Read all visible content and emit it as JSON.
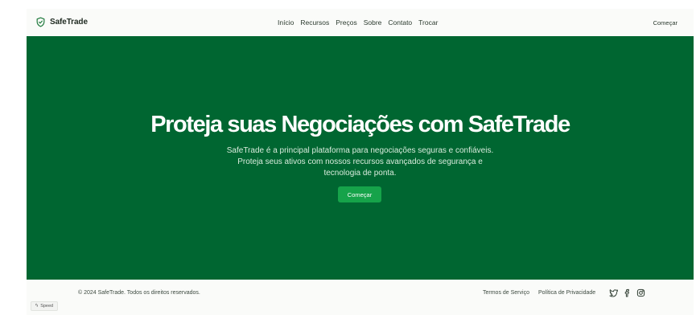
{
  "header": {
    "brand": "SafeTrade",
    "nav": [
      "Início",
      "Recursos",
      "Preços",
      "Sobre",
      "Contato",
      "Trocar"
    ],
    "cta": "Começar"
  },
  "hero": {
    "title": "Proteja suas Negociações com SafeTrade",
    "subtitle": "SafeTrade é a principal plataforma para negociações seguras e confiáveis. Proteja seus ativos com nossos recursos avançados de segurança e tecnologia de ponta.",
    "button": "Começar",
    "background_color": "#006631",
    "button_color": "#16a34a"
  },
  "footer": {
    "copyright": "© 2024 SafeTrade. Todos os direitos reservados.",
    "links": [
      "Termos de Serviço",
      "Política de Privacidade"
    ],
    "social_icons": [
      "twitter-icon",
      "facebook-icon",
      "instagram-icon"
    ]
  },
  "badge": {
    "icon": "lightning-icon",
    "label": "Speed"
  }
}
